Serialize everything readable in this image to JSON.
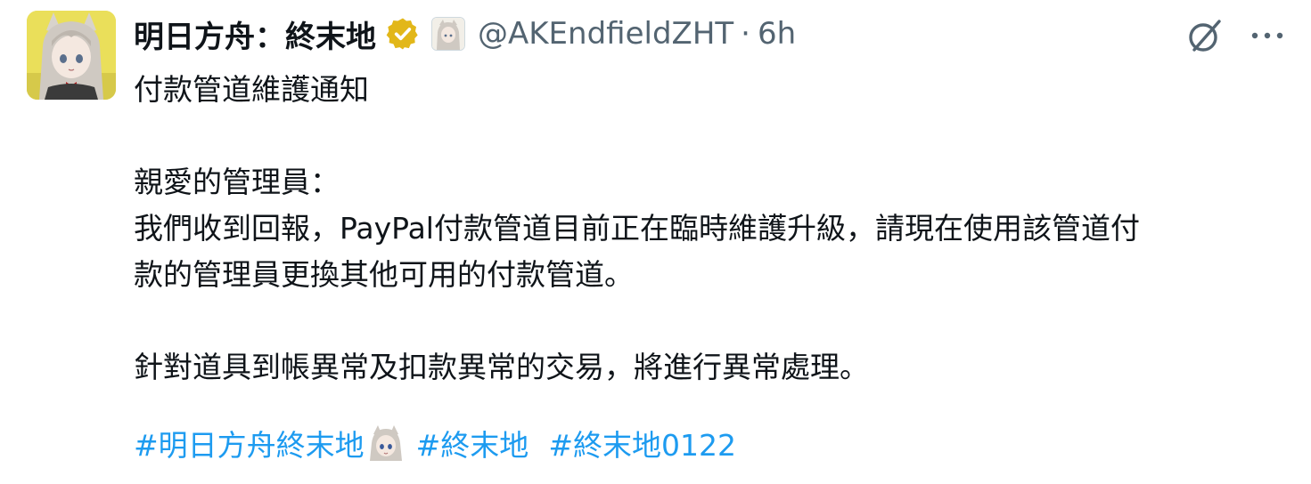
{
  "author": {
    "display_name": "明日方舟：終末地",
    "handle": "@AKEndfieldZHT",
    "separator": "·",
    "time": "6h",
    "avatar_icon": "anime-character-avatar",
    "verified_icon": "gold-verified-badge-icon",
    "verified_color": "#e2b719",
    "affiliate_icon": "affiliate-avatar-icon"
  },
  "actions": {
    "grok_icon": "grok-icon",
    "more_icon": "more-dots-icon"
  },
  "tweet": {
    "title": "付款管道維護通知",
    "greeting": "親愛的管理員：",
    "line1": "我們收到回報，PayPal付款管道目前正在臨時維護升級，請現在使用該管道付",
    "line2": "款的管理員更換其他可用的付款管道。",
    "line3": "針對道具到帳異常及扣款異常的交易，將進行異常處理。"
  },
  "hashtags": {
    "tag1": "#明日方舟終末地",
    "tag1_emoji": "character-emoji",
    "tag2": "#終末地",
    "tag3": "#終末地0122",
    "color": "#1d9bf0"
  }
}
